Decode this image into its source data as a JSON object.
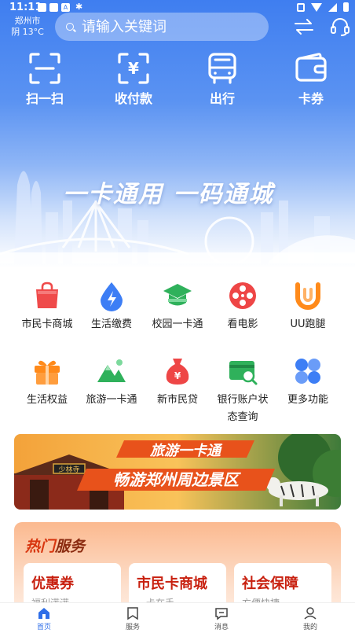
{
  "status_bar": {
    "time": "11:11",
    "notif_icon": "bug-icon"
  },
  "location": {
    "city": "郑州市",
    "weather": "阴 13°C"
  },
  "search": {
    "placeholder": "请输入关键词"
  },
  "quick_actions": [
    {
      "label": "扫一扫",
      "icon": "scan-icon"
    },
    {
      "label": "收付款",
      "icon": "payment-code-icon"
    },
    {
      "label": "出行",
      "icon": "bus-icon"
    },
    {
      "label": "卡券",
      "icon": "wallet-icon"
    }
  ],
  "hero": {
    "slogan": "一卡通用  一码通城"
  },
  "services": [
    {
      "label": "市民卡商城",
      "icon": "shopping-bag-icon",
      "color": "#ef4a4a"
    },
    {
      "label": "生活缴费",
      "icon": "water-drop-icon",
      "color": "#3d7ef5"
    },
    {
      "label": "校园一卡通",
      "icon": "graduation-cap-icon",
      "color": "#2fb15b"
    },
    {
      "label": "看电影",
      "icon": "film-reel-icon",
      "color": "#ee4646"
    },
    {
      "label": "UU跑腿",
      "icon": "uu-icon",
      "color": "#ff8a1a"
    },
    {
      "label": "生活权益",
      "icon": "gift-icon",
      "color": "#ff8a1a"
    },
    {
      "label": "旅游一卡通",
      "icon": "mountain-icon",
      "color": "#2fb15b"
    },
    {
      "label": "新市民贷",
      "icon": "money-bag-icon",
      "color": "#ee4646"
    },
    {
      "label": "银行账户状态查询",
      "label_line1": "银行账户状",
      "label_line2": "态查询",
      "icon": "bank-card-search-icon",
      "color": "#2fb15b"
    },
    {
      "label": "更多功能",
      "icon": "grid-more-icon",
      "color": "#3d7ef5"
    }
  ],
  "banner": {
    "line1": "旅游一卡通",
    "line2": "畅游郑州周边景区",
    "sign_text": "少林寺"
  },
  "hot": {
    "title_a": "热门",
    "title_b": "服务",
    "cards": [
      {
        "title": "优惠券",
        "subtitle": "福利满满"
      },
      {
        "title": "市民卡商城",
        "subtitle": "一卡在手"
      },
      {
        "title": "社会保障",
        "subtitle": "方便快捷"
      }
    ]
  },
  "nav": [
    {
      "label": "首页",
      "icon": "home-icon",
      "active": true
    },
    {
      "label": "服务",
      "icon": "bookmark-icon",
      "active": false
    },
    {
      "label": "消息",
      "icon": "message-icon",
      "active": false
    },
    {
      "label": "我的",
      "icon": "user-icon",
      "active": false
    }
  ],
  "colors": {
    "primary": "#3f7ef0",
    "nav_active": "#2f6ee8",
    "hot_title": "#d8360f"
  }
}
